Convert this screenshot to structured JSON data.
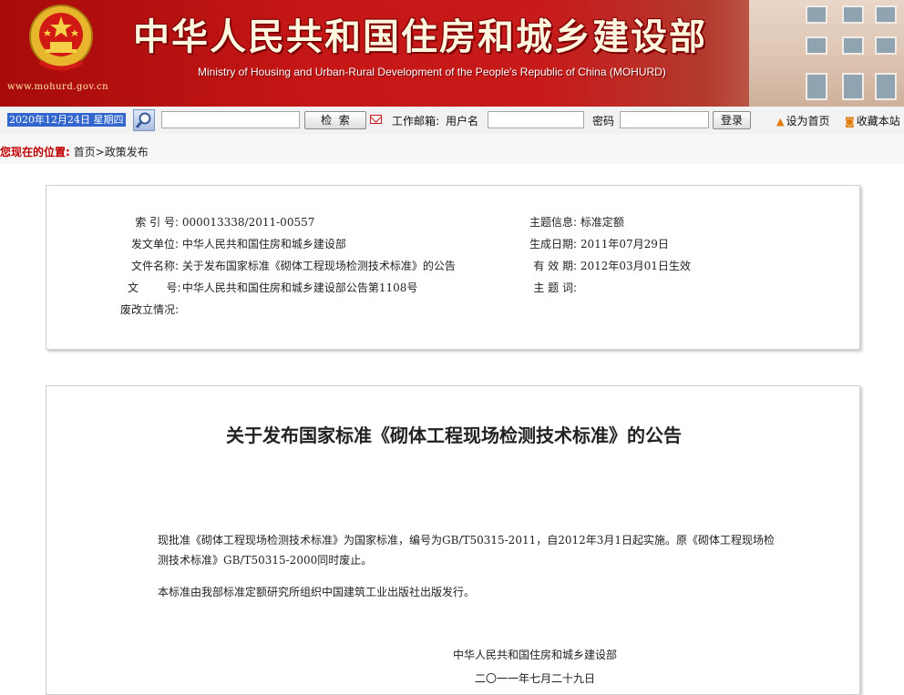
{
  "header": {
    "site_url": "www.mohurd.gov.cn",
    "title_cn": "中华人民共和国住房和城乡建设部",
    "title_en": "Ministry of Housing and Urban-Rural Development of the People's Republic of China (MOHURD)"
  },
  "toolbar": {
    "date": "2020年12月24日 星期四",
    "search_value": "",
    "search_button": "检  索",
    "mail_label": "工作邮箱:",
    "username_label": "用户名",
    "username_value": "",
    "password_label": "密码",
    "password_value": "",
    "login_button": "登录",
    "set_home": "设为首页",
    "bookmark": "收藏本站"
  },
  "breadcrumb": {
    "lead": "您现在的位置:",
    "home": "首页",
    "sep": ">",
    "current": "政策发布"
  },
  "meta": {
    "index_no_label": "索 引 号:",
    "index_no": "000013338/2011-00557",
    "issuer_label": "发文单位:",
    "issuer": "中华人民共和国住房和城乡建设部",
    "filename_label": "文件名称:",
    "filename": "关于发布国家标准《砌体工程现场检测技术标准》的公告",
    "doc_no_label": "文        号:",
    "doc_no": "中华人民共和国住房和城乡建设部公告第1108号",
    "revision_label": "废改立情况:",
    "revision": "",
    "topic_label": "主题信息:",
    "topic": "标准定额",
    "date_label": "生成日期:",
    "date": "2011年07月29日",
    "valid_label": "有 效 期:",
    "valid": "2012年03月01日生效",
    "keywords_label": "主 题 词:",
    "keywords": ""
  },
  "article": {
    "title": "关于发布国家标准《砌体工程现场检测技术标准》的公告",
    "para1": "现批准《砌体工程现场检测技术标准》为国家标准，编号为GB/T50315-2011，自2012年3月1日起实施。原《砌体工程现场检测技术标准》GB/T50315-2000同时废止。",
    "para2": "本标准由我部标准定额研究所组织中国建筑工业出版社出版发行。",
    "signer": "中华人民共和国住房和城乡建设部",
    "sign_date": "二〇一一年七月二十九日"
  },
  "colors": {
    "banner_red": "#c61616",
    "date_highlight": "#3266cc",
    "breadcrumb_lead": "#c00000"
  }
}
